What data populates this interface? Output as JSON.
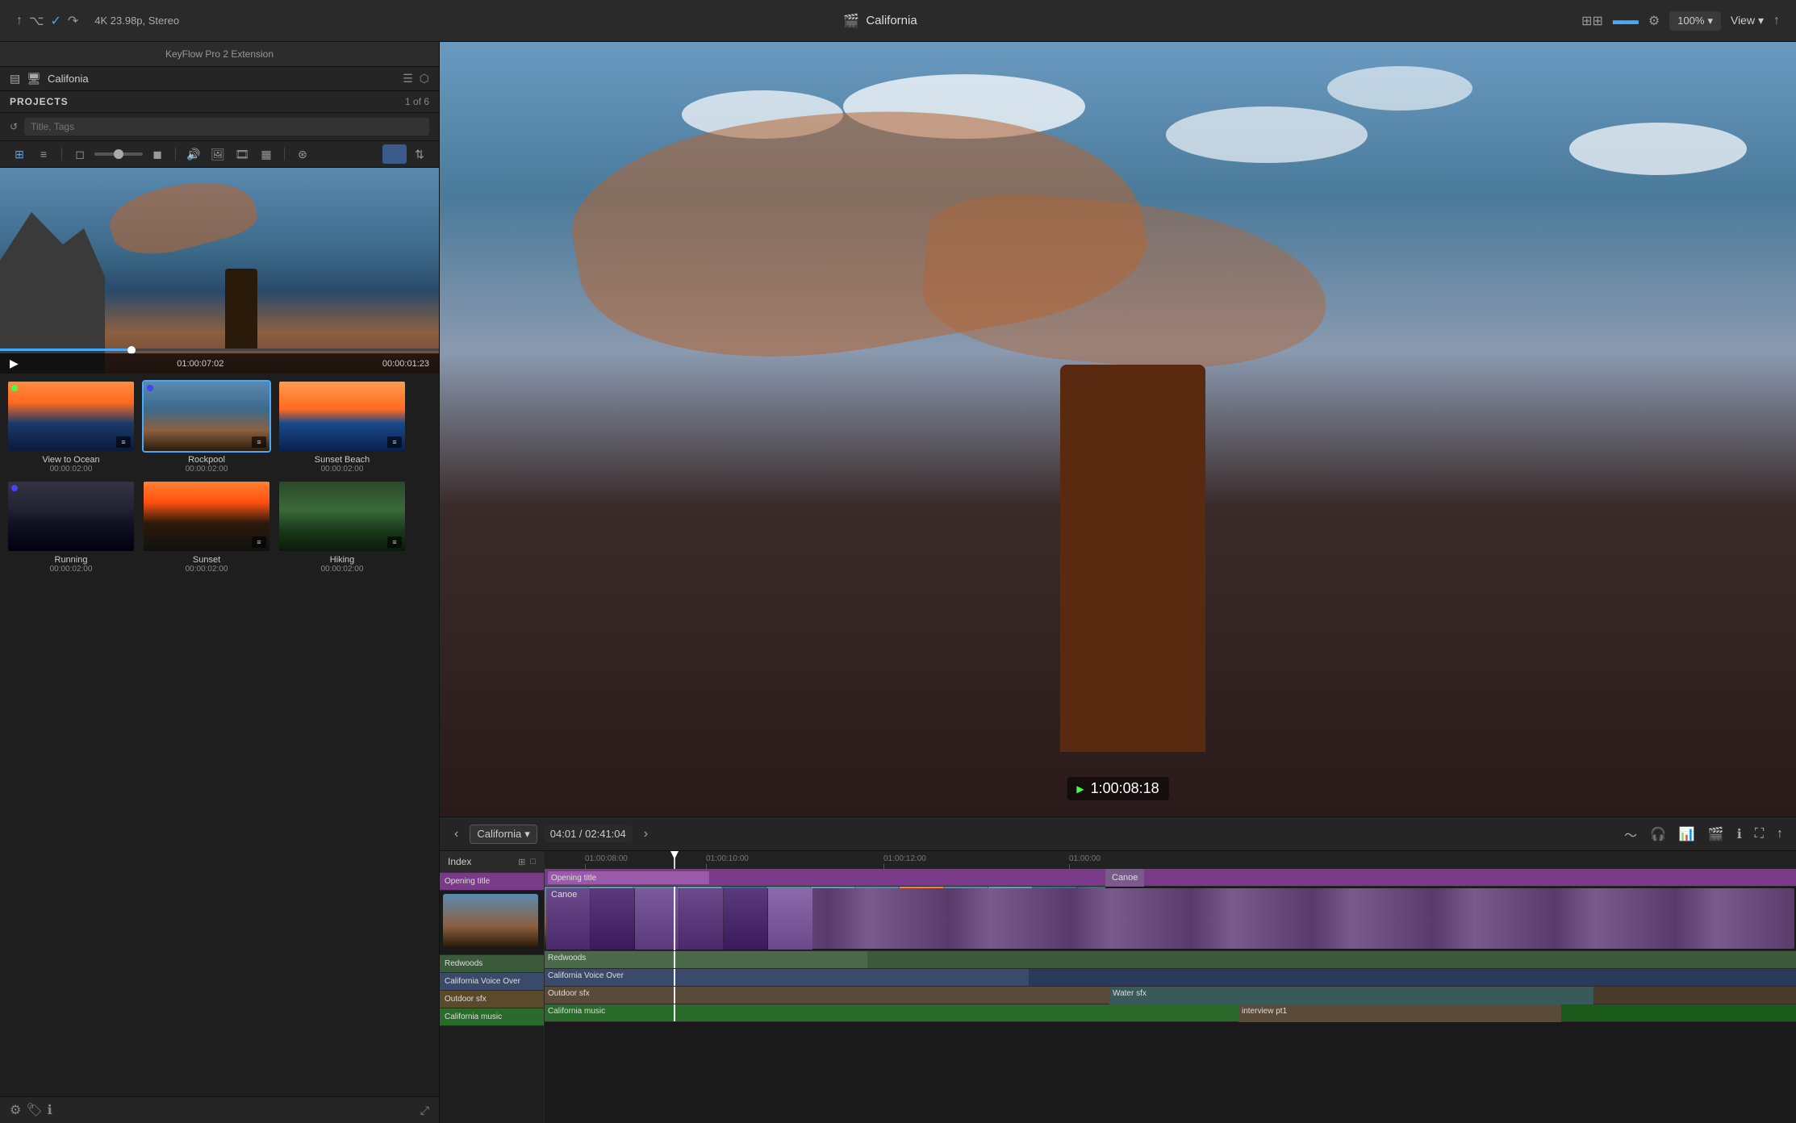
{
  "titlebar": {
    "status": "4K 23.98p, Stereo",
    "title": "California",
    "zoom": "100%",
    "view_label": "View",
    "film_icon": "🎬"
  },
  "keyflow": {
    "title": "KeyFlow Pro 2 Extension",
    "monitor_label": "Califonia",
    "projects_label": "PROJECTS",
    "projects_count": "1 of 6",
    "search_placeholder": "Title, Tags",
    "clips": [
      {
        "name": "View to Ocean",
        "duration": "00:00:02:00",
        "type": "ocean",
        "dot": "green"
      },
      {
        "name": "Rockpool",
        "duration": "00:00:02:00",
        "type": "rock",
        "dot": "blue",
        "selected": true
      },
      {
        "name": "Sunset Beach",
        "duration": "00:00:02:00",
        "type": "sunset",
        "dot": "none"
      },
      {
        "name": "Running",
        "duration": "00:00:02:00",
        "type": "running",
        "dot": "blue"
      },
      {
        "name": "Sunset",
        "duration": "00:00:02:00",
        "type": "sunset2",
        "dot": "none"
      },
      {
        "name": "Hiking",
        "duration": "00:00:02:00",
        "type": "hiking",
        "dot": "none"
      }
    ],
    "preview": {
      "timecode_left": "01:00:07:02",
      "timecode_right": "00:00:01:23"
    }
  },
  "main_preview": {
    "timecode": "1:00:08:18"
  },
  "timeline": {
    "prev_label": "‹",
    "next_label": "›",
    "project_name": "California",
    "timecode": "04:01 / 02:41:04",
    "ruler_marks": [
      "01:00:08:00",
      "01:00:10:00",
      "01:00:12:00",
      "01:00:00"
    ],
    "tracks": {
      "video": "video",
      "canoe_label": "Canoe",
      "opening_title": "Opening title",
      "redwoods": "Redwoods",
      "voice_over": "California Voice Over",
      "outdoor_sfx": "Outdoor sfx",
      "california_music": "California music",
      "water_sfx": "Water sfx",
      "interview": "interview pt1"
    }
  },
  "index": {
    "tab_label": "Index"
  },
  "icons": {
    "play": "▶",
    "film": "🎬",
    "grid": "⊞",
    "list": "≡",
    "search": "🔍",
    "settings": "⚙",
    "refresh": "↺",
    "fullscreen": "⤢",
    "arrow_left": "‹",
    "arrow_right": "›",
    "audio_wave": "〜",
    "headphone": "🎧",
    "speaker": "🔊",
    "minus": "−",
    "plus": "+",
    "zoom_in": "⊕",
    "share": "↑"
  }
}
